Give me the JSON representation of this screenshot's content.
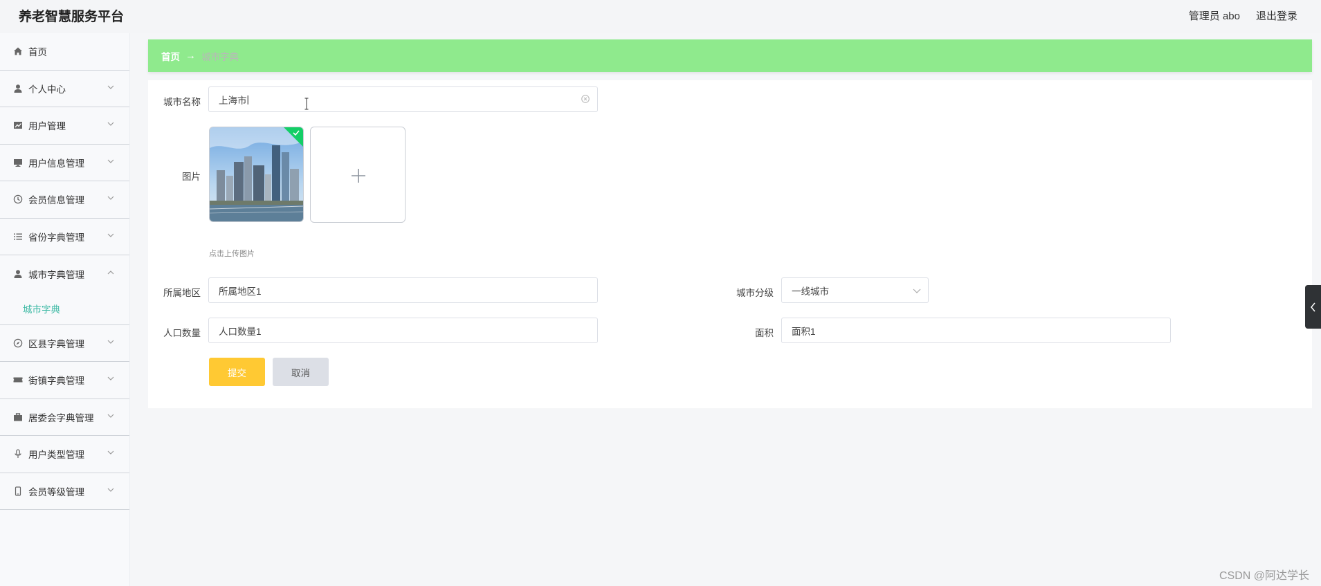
{
  "header": {
    "brand": "养老智慧服务平台",
    "user_label": "管理员 abo",
    "logout_label": "退出登录"
  },
  "sidebar": {
    "items": [
      {
        "label": "首页",
        "icon": "home-icon"
      },
      {
        "label": "个人中心",
        "icon": "user-icon"
      },
      {
        "label": "用户管理",
        "icon": "chart-icon"
      },
      {
        "label": "用户信息管理",
        "icon": "monitor-icon"
      },
      {
        "label": "会员信息管理",
        "icon": "clock-icon"
      },
      {
        "label": "省份字典管理",
        "icon": "list-icon"
      },
      {
        "label": "城市字典管理",
        "icon": "user-icon",
        "expanded": true
      },
      {
        "label": "区县字典管理",
        "icon": "compass-icon"
      },
      {
        "label": "街镇字典管理",
        "icon": "ticket-icon"
      },
      {
        "label": "居委会字典管理",
        "icon": "briefcase-icon"
      },
      {
        "label": "用户类型管理",
        "icon": "microphone-icon"
      },
      {
        "label": "会员等级管理",
        "icon": "phone-icon"
      }
    ],
    "active_sub": "城市字典"
  },
  "breadcrumb": {
    "home": "首页",
    "arrow": "→",
    "current": "城市字典"
  },
  "form": {
    "city_name": {
      "label": "城市名称",
      "value": "上海市"
    },
    "image": {
      "label": "图片",
      "tip": "点击上传图片"
    },
    "region": {
      "label": "所属地区",
      "value": "所属地区1"
    },
    "city_level": {
      "label": "城市分级",
      "value": "一线城市"
    },
    "population": {
      "label": "人口数量",
      "value": "人口数量1"
    },
    "area": {
      "label": "面积",
      "value": "面积1"
    },
    "submit_label": "提交",
    "cancel_label": "取消"
  },
  "watermark": "CSDN @阿达学长",
  "colors": {
    "breadcrumb_bg": "#8fea8d",
    "submit_bg": "#ffc933",
    "cancel_bg": "#dcdfe6",
    "active_sub": "#3cb9a4",
    "upload_success": "#13ce66"
  }
}
